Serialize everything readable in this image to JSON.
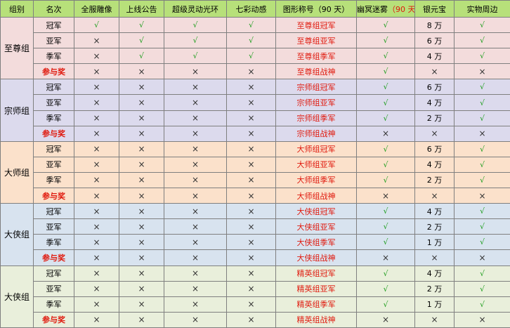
{
  "header": {
    "group": "组别",
    "rank": "名次",
    "statue": "全服雕像",
    "announce": "上线公告",
    "aura": "超级灵动光环",
    "dynamic": "七彩动感",
    "title": "图形称号（90 天）",
    "mist_main": "幽冥迷雾",
    "mist_days": "（90 天）",
    "silver": "银元宝",
    "gift": "实物周边"
  },
  "symbols": {
    "check": "√",
    "cross": "×"
  },
  "groups": [
    {
      "name": "至尊组",
      "rows": [
        {
          "rank": "冠军",
          "statue": true,
          "announce": true,
          "aura": true,
          "dynamic": true,
          "title": "至尊组冠军",
          "mist": true,
          "silver": "8 万",
          "gift": true
        },
        {
          "rank": "亚军",
          "statue": false,
          "announce": true,
          "aura": true,
          "dynamic": true,
          "title": "至尊组亚军",
          "mist": true,
          "silver": "6 万",
          "gift": true
        },
        {
          "rank": "季军",
          "statue": false,
          "announce": true,
          "aura": true,
          "dynamic": true,
          "title": "至尊组季军",
          "mist": true,
          "silver": "4 万",
          "gift": true
        },
        {
          "rank": "参与奖",
          "participation": true,
          "statue": false,
          "announce": false,
          "aura": false,
          "dynamic": false,
          "title": "至尊组战神",
          "mist": true,
          "silver": null,
          "gift": false
        }
      ]
    },
    {
      "name": "宗师组",
      "rows": [
        {
          "rank": "冠军",
          "statue": false,
          "announce": false,
          "aura": false,
          "dynamic": false,
          "title": "宗师组冠军",
          "mist": true,
          "silver": "6 万",
          "gift": true
        },
        {
          "rank": "亚军",
          "statue": false,
          "announce": false,
          "aura": false,
          "dynamic": false,
          "title": "宗师组亚军",
          "mist": true,
          "silver": "4 万",
          "gift": true
        },
        {
          "rank": "季军",
          "statue": false,
          "announce": false,
          "aura": false,
          "dynamic": false,
          "title": "宗师组季军",
          "mist": true,
          "silver": "2 万",
          "gift": true
        },
        {
          "rank": "参与奖",
          "participation": true,
          "statue": false,
          "announce": false,
          "aura": false,
          "dynamic": false,
          "title": "宗师组战神",
          "mist": false,
          "silver": null,
          "gift": false
        }
      ]
    },
    {
      "name": "大师组",
      "rows": [
        {
          "rank": "冠军",
          "statue": false,
          "announce": false,
          "aura": false,
          "dynamic": false,
          "title": "大师组冠军",
          "mist": true,
          "silver": "6 万",
          "gift": true
        },
        {
          "rank": "亚军",
          "statue": false,
          "announce": false,
          "aura": false,
          "dynamic": false,
          "title": "大师组亚军",
          "mist": true,
          "silver": "4 万",
          "gift": true
        },
        {
          "rank": "季军",
          "statue": false,
          "announce": false,
          "aura": false,
          "dynamic": false,
          "title": "大师组季军",
          "mist": true,
          "silver": "2 万",
          "gift": true
        },
        {
          "rank": "参与奖",
          "participation": true,
          "statue": false,
          "announce": false,
          "aura": false,
          "dynamic": false,
          "title": "大师组战神",
          "mist": false,
          "silver": null,
          "gift": false
        }
      ]
    },
    {
      "name": "大侠组",
      "rows": [
        {
          "rank": "冠军",
          "statue": false,
          "announce": false,
          "aura": false,
          "dynamic": false,
          "title": "大侠组冠军",
          "mist": true,
          "silver": "4 万",
          "gift": true
        },
        {
          "rank": "亚军",
          "statue": false,
          "announce": false,
          "aura": false,
          "dynamic": false,
          "title": "大侠组亚军",
          "mist": true,
          "silver": "2 万",
          "gift": true
        },
        {
          "rank": "季军",
          "statue": false,
          "announce": false,
          "aura": false,
          "dynamic": false,
          "title": "大侠组季军",
          "mist": true,
          "silver": "1 万",
          "gift": true
        },
        {
          "rank": "参与奖",
          "participation": true,
          "statue": false,
          "announce": false,
          "aura": false,
          "dynamic": false,
          "title": "大侠组战神",
          "mist": false,
          "silver": null,
          "gift": false
        }
      ]
    },
    {
      "name": "大侠组",
      "rows": [
        {
          "rank": "冠军",
          "statue": false,
          "announce": false,
          "aura": false,
          "dynamic": false,
          "title": "精英组冠军",
          "mist": true,
          "silver": "4 万",
          "gift": true
        },
        {
          "rank": "亚军",
          "statue": false,
          "announce": false,
          "aura": false,
          "dynamic": false,
          "title": "精英组亚军",
          "mist": true,
          "silver": "2 万",
          "gift": true
        },
        {
          "rank": "季军",
          "statue": false,
          "announce": false,
          "aura": false,
          "dynamic": false,
          "title": "精英组季军",
          "mist": true,
          "silver": "1 万",
          "gift": true
        },
        {
          "rank": "参与奖",
          "participation": true,
          "statue": false,
          "announce": false,
          "aura": false,
          "dynamic": false,
          "title": "精英组战神",
          "mist": false,
          "silver": null,
          "gift": false
        }
      ]
    }
  ]
}
